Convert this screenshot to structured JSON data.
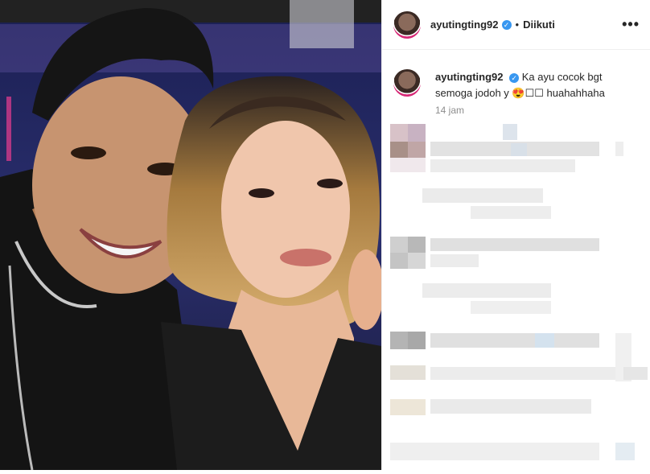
{
  "post": {
    "username": "ayutingting92",
    "verified_mark": "✓",
    "separator": "•",
    "follow_status": "Diikuti",
    "more_icon": "•••",
    "caption_username": "ayutingting92",
    "caption_text": "Ka ayu cocok bgt semoga jodoh y 😍☐☐ huahahhaha",
    "time_ago": "14 jam"
  },
  "colors": {
    "verified": "#3897f0",
    "text": "#262626",
    "muted": "#8e8e8e"
  }
}
